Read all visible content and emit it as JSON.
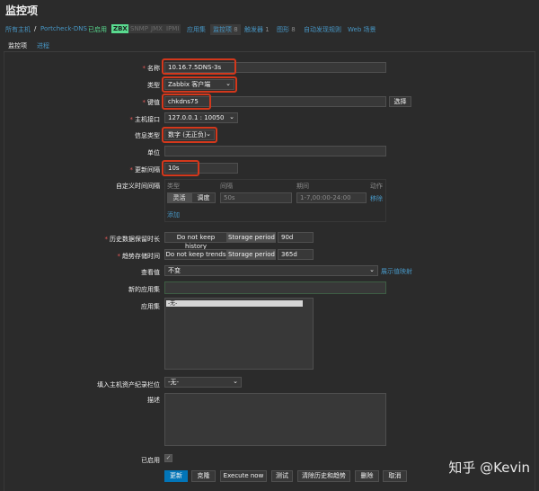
{
  "page": {
    "title": "监控项"
  },
  "nav": {
    "all_hosts": "所有主机",
    "sep": "/",
    "host": "Portcheck-DNS",
    "status": "已启用",
    "zbx": "ZBX",
    "snmp": "SNMP",
    "jmx": "JMX",
    "ipmi": "IPMI",
    "applications": "应用集",
    "items": "监控项",
    "items_count": "8",
    "triggers": "触发器",
    "triggers_count": "1",
    "graphs": "图形",
    "graphs_count": "8",
    "discovery": "自动发现规则",
    "web": "Web 场景"
  },
  "tabs": {
    "item": "监控项",
    "process": "进程"
  },
  "form": {
    "name": {
      "label": "名称",
      "value": "10.16.7.5DNS-3s"
    },
    "type": {
      "label": "类型",
      "value": "Zabbix 客户端"
    },
    "key": {
      "label": "键值",
      "value": "chkdns75",
      "select_btn": "选择"
    },
    "host_interface": {
      "label": "主机接口",
      "value": "127.0.0.1 : 10050"
    },
    "info_type": {
      "label": "信息类型",
      "value": "数字 (无正负)"
    },
    "units": {
      "label": "单位",
      "value": ""
    },
    "update_interval": {
      "label": "更新间隔",
      "value": "10s"
    },
    "custom_intervals": {
      "label": "自定义时间间隔",
      "col_type": "类型",
      "col_interval": "间隔",
      "col_period": "期间",
      "col_action": "动作",
      "flexible": "灵活",
      "scheduling": "调度",
      "interval_placeholder": "50s",
      "period_placeholder": "1-7,00:00-24:00",
      "remove": "移除",
      "add": "添加"
    },
    "history": {
      "label": "历史数据保留时长",
      "no_keep": "Do not keep history",
      "storage": "Storage period",
      "value": "90d"
    },
    "trends": {
      "label": "趋势存储时间",
      "no_keep": "Do not keep trends",
      "storage": "Storage period",
      "value": "365d"
    },
    "show_value": {
      "label": "查看值",
      "value": "不变",
      "link": "展示值映射"
    },
    "new_app": {
      "label": "新的应用集",
      "value": ""
    },
    "apps": {
      "label": "应用集",
      "selected": "-无-"
    },
    "inventory": {
      "label": "填入主机资产纪录栏位",
      "value": "-无-"
    },
    "description": {
      "label": "描述",
      "value": ""
    },
    "enabled": {
      "label": "已启用",
      "check": "✓"
    }
  },
  "buttons": {
    "update": "更新",
    "clone": "克隆",
    "execute": "Execute now",
    "test": "测试",
    "clear": "清除历史和趋势",
    "delete": "删除",
    "cancel": "取消"
  },
  "watermark": "知乎 @Kevin"
}
